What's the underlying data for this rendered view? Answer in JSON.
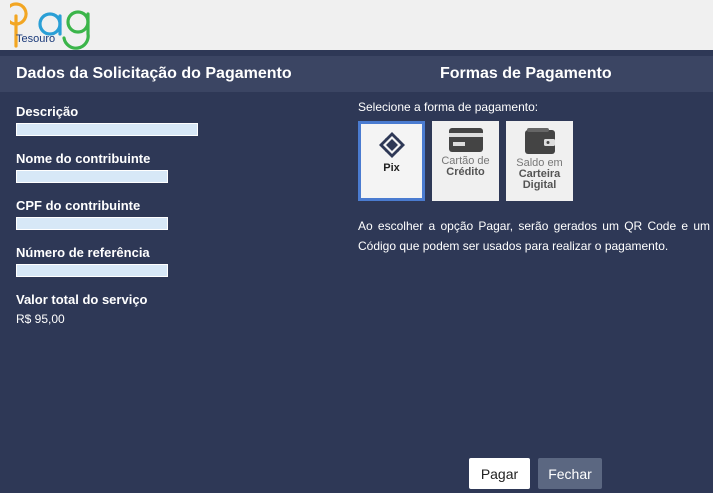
{
  "header": {
    "logo_text": "pag",
    "logo_subtext": "Tesouro"
  },
  "sections": {
    "left_title": "Dados da Solicitação do Pagamento",
    "right_title": "Formas de Pagamento"
  },
  "fields": {
    "descricao_label": "Descrição",
    "nome_label": "Nome do contribuinte",
    "cpf_label": "CPF do contribuinte",
    "referencia_label": "Número de referência",
    "valor_label": "Valor total do serviço",
    "valor_value": "R$  95,00"
  },
  "payment": {
    "select_text": "Selecione a forma de pagamento:",
    "options": [
      {
        "icon": "pix-icon",
        "label_line1": "Pix",
        "label_line2": "",
        "label_line3": "",
        "selected": true
      },
      {
        "icon": "credit-card-icon",
        "label_line1": "Cartão de",
        "label_line2": "Crédito",
        "label_line3": "",
        "selected": false
      },
      {
        "icon": "wallet-icon",
        "label_line1": "Saldo em",
        "label_line2": "Carteira",
        "label_line3": "Digital",
        "selected": false
      }
    ],
    "info_text": "Ao escolher a opção Pagar, serão gerados um QR Code e um Código que podem ser usados para realizar o pagamento."
  },
  "buttons": {
    "pagar": "Pagar",
    "fechar": "Fechar"
  },
  "colors": {
    "background": "#2e3856",
    "header_bar": "#3b4563",
    "selected_border": "#4a7bd0",
    "field_fill": "#d7e8f7"
  }
}
